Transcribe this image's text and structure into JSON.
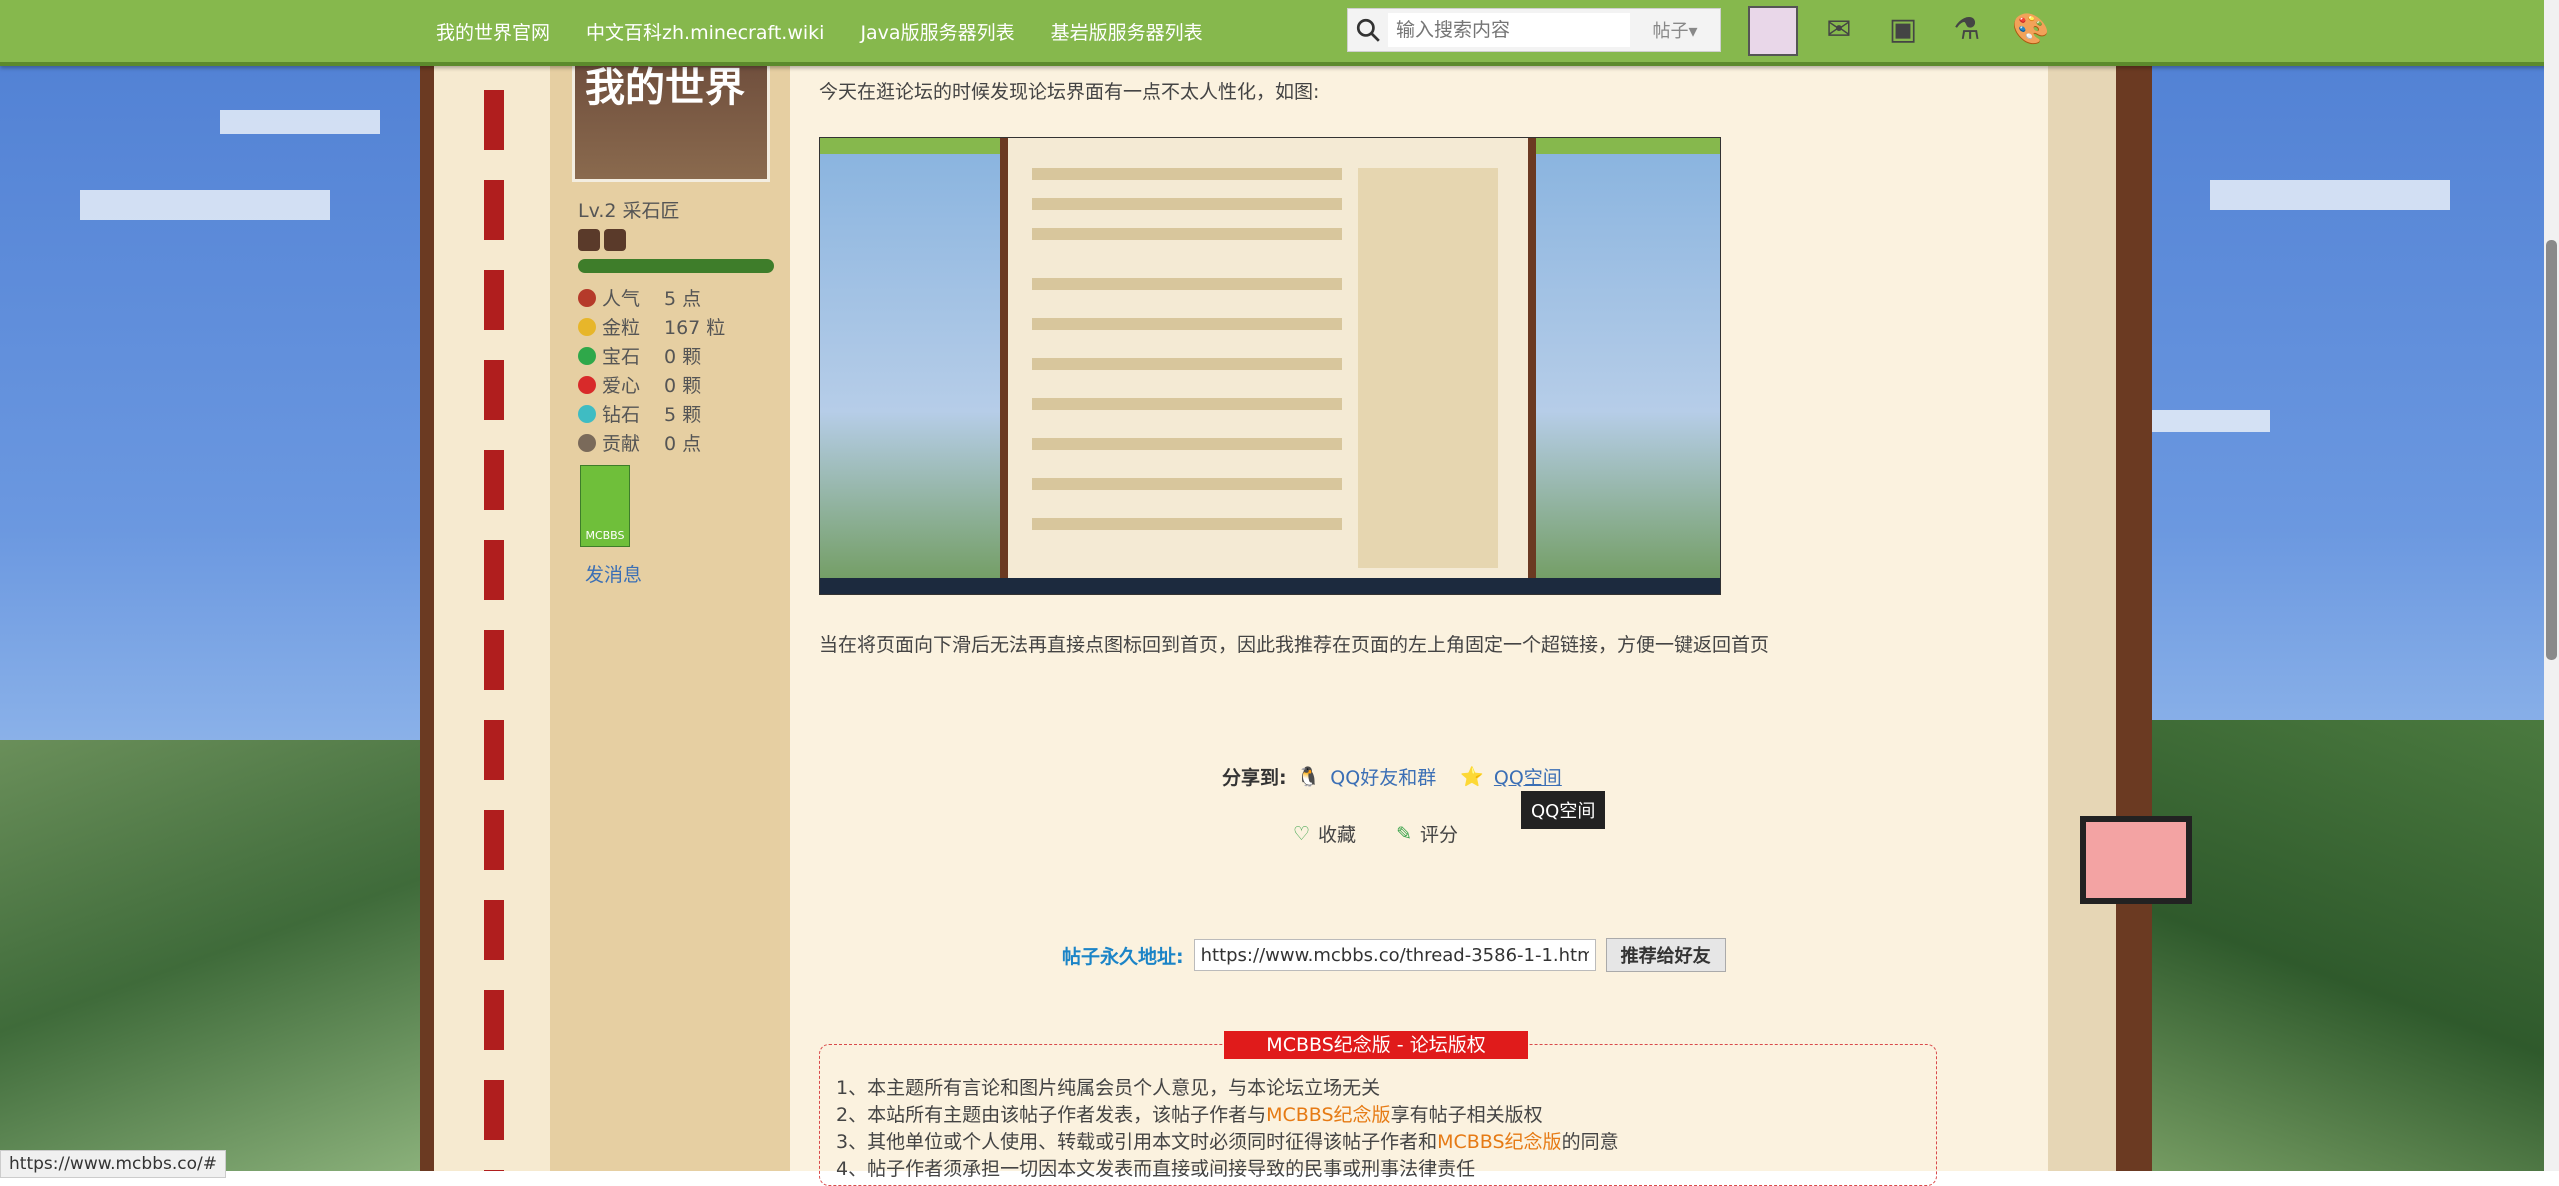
{
  "nav": {
    "links": [
      "我的世界官网",
      "中文百科zh.minecraft.wiki",
      "Java版服务器列表",
      "基岩版服务器列表"
    ]
  },
  "search": {
    "placeholder": "输入搜索内容",
    "type_select": "帖子▾"
  },
  "user": {
    "level": "Lv.2 采石匠",
    "stats": [
      {
        "label": "人气",
        "value": "5 点",
        "color": "#b53a2a"
      },
      {
        "label": "金粒",
        "value": "167 粒",
        "color": "#e7b62a"
      },
      {
        "label": "宝石",
        "value": "0 颗",
        "color": "#2fa84a"
      },
      {
        "label": "爱心",
        "value": "0 颗",
        "color": "#d82a2a"
      },
      {
        "label": "钻石",
        "value": "5 颗",
        "color": "#3fbcc3"
      },
      {
        "label": "贡献",
        "value": "0 点",
        "color": "#7a6a5a"
      }
    ],
    "medal_text": "MCBBS",
    "send_message": "发消息",
    "avatar_text": "我的世界"
  },
  "post": {
    "para1": "今天在逛论坛的时候发现论坛界面有一点不太人性化，如图:",
    "para2": "当在将页面向下滑后无法再直接点图标回到首页，因此我推荐在页面的左上角固定一个超链接，方便一键返回首页"
  },
  "share": {
    "label": "分享到:",
    "qq_friends": "QQ好友和群",
    "qzone": "QQ空间",
    "tooltip": "QQ空间"
  },
  "actions": {
    "favorite": "收藏",
    "rate": "评分"
  },
  "permalink": {
    "label": "帖子永久地址:",
    "url": "https://www.mcbbs.co/thread-3586-1-1.htm",
    "button": "推荐给好友"
  },
  "copyright": {
    "title": "MCBBS纪念版 - 论坛版权",
    "line1": "1、本主题所有言论和图片纯属会员个人意见，与本论坛立场无关",
    "line2_a": "2、本站所有主题由该帖子作者发表，该帖子作者与",
    "line2_b": "MCBBS纪念版",
    "line2_c": "享有帖子相关版权",
    "line3_a": "3、其他单位或个人使用、转载或引用本文时必须同时征得该帖子作者和",
    "line3_b": "MCBBS纪念版",
    "line3_c": "的同意",
    "line4": "4、帖子作者须承担一切因本文发表而直接或间接导致的民事或刑事法律责任"
  },
  "status_url": "https://www.mcbbs.co/#"
}
